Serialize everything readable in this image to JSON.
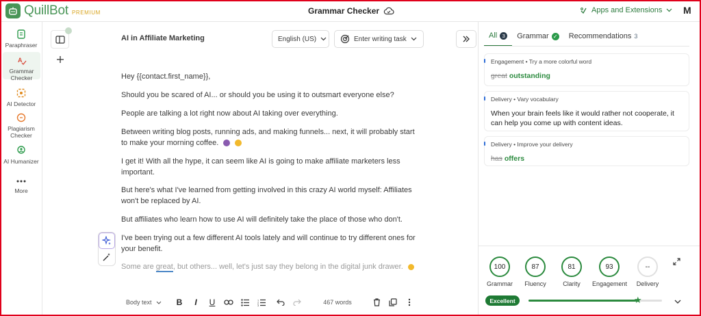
{
  "app": {
    "logo_text": "QuillBot",
    "logo_badge": "PREMIUM",
    "page_title": "Grammar Checker",
    "apps_menu_label": "Apps and Extensions",
    "user_initial": "M"
  },
  "sidebar": {
    "items": [
      {
        "label": "Paraphraser",
        "icon": "paraphraser-icon"
      },
      {
        "label": "Grammar Checker",
        "icon": "grammar-checker-icon",
        "active": true
      },
      {
        "label": "AI Detector",
        "icon": "ai-detector-icon"
      },
      {
        "label": "Plagiarism Checker",
        "icon": "plagiarism-icon"
      },
      {
        "label": "AI Humanizer",
        "icon": "humanizer-icon"
      },
      {
        "label": "More",
        "icon": "more-dots-icon"
      }
    ]
  },
  "editor": {
    "doc_title": "AI in Affiliate Marketing",
    "language": "English (US)",
    "task_placeholder": "Enter writing task",
    "paragraphs": [
      "Hey {{contact.first_name}},",
      "Should you be scared of AI... or should you be using it to outsmart everyone else?",
      "People are talking a lot right now about AI taking over everything.",
      "Between writing blog posts, running ads, and making funnels... next, it will probably start to make your morning coffee.",
      "I get it! With all the hype, it can seem like AI is going to make affiliate marketers less important.",
      "But here's what I've learned from getting involved in this crazy AI world myself: Affiliates won't be replaced by AI.",
      "But affiliates who learn how to use AI will definitely take the place of those who don't.",
      "I've been trying out a few different AI tools lately and will continue to try different ones for your benefit."
    ],
    "last_paragraph": {
      "before": "Some are ",
      "flagged": "great",
      "after": ", but others... well, let's just say they belong in the digital junk drawer."
    },
    "toolbar": {
      "style_label": "Body text",
      "word_count": "467 words"
    }
  },
  "panel": {
    "tabs": [
      {
        "label": "All",
        "count": "3"
      },
      {
        "label": "Grammar"
      },
      {
        "label": "Recommendations",
        "count": "3"
      }
    ],
    "suggestions": [
      {
        "category": "Engagement",
        "type": "Try a more colorful word",
        "original": "great",
        "replacement": "outstanding"
      },
      {
        "category": "Delivery",
        "type": "Vary vocabulary",
        "text": "When your brain feels like it would rather not cooperate, it can help you come up with content ideas."
      },
      {
        "category": "Delivery",
        "type": "Improve your delivery",
        "original": "has",
        "replacement": "offers"
      }
    ],
    "scores": [
      {
        "label": "Grammar",
        "value": "100"
      },
      {
        "label": "Fluency",
        "value": "87"
      },
      {
        "label": "Clarity",
        "value": "81"
      },
      {
        "label": "Engagement",
        "value": "93"
      },
      {
        "label": "Delivery",
        "value": "--"
      }
    ],
    "overall_label": "Excellent",
    "overall_progress": 0.81,
    "colors": {
      "brand_green": "#499557",
      "accent_green": "#2b8a3e",
      "frame_red": "#e0001b"
    }
  }
}
